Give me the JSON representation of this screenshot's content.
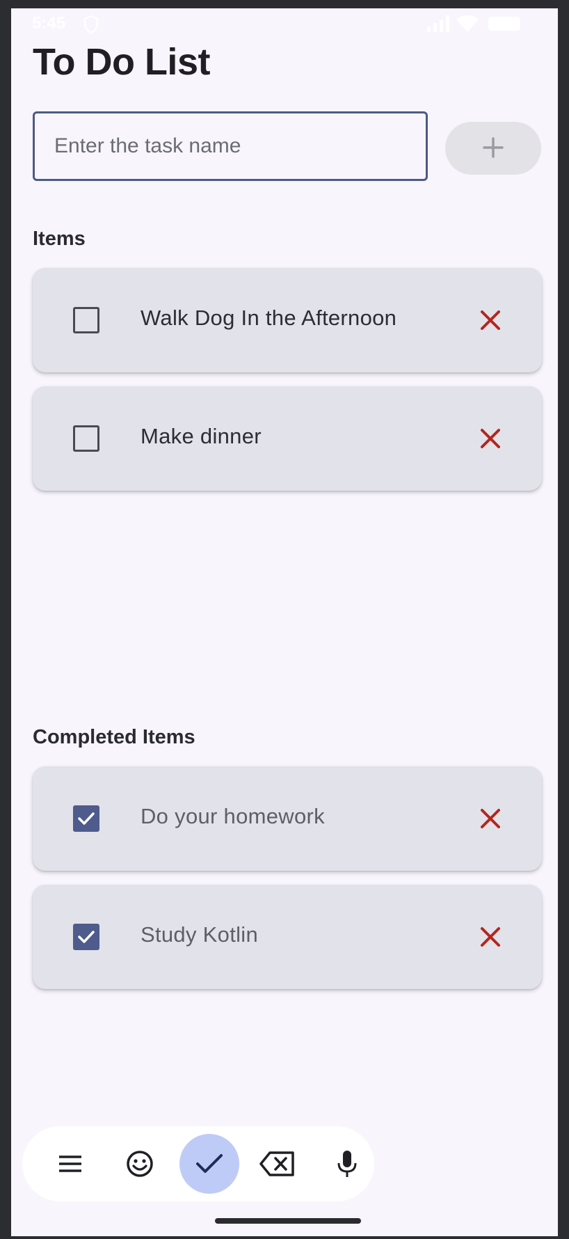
{
  "status_bar": {
    "time": "5:45",
    "icons": [
      "shield-icon",
      "signal-icon",
      "wifi-icon",
      "battery-icon"
    ]
  },
  "header": {
    "title": "To Do List"
  },
  "new_task": {
    "placeholder": "Enter the task name",
    "add_icon": "plus-icon",
    "value": ""
  },
  "sections": {
    "items_label": "Items",
    "completed_label": "Completed Items"
  },
  "items": [
    {
      "label": "Walk Dog In the Afternoon",
      "checked": false
    },
    {
      "label": "Make dinner",
      "checked": false
    }
  ],
  "completed_items": [
    {
      "label": "Do your homework",
      "checked": true
    },
    {
      "label": "Study Kotlin",
      "checked": true
    }
  ],
  "keyboard_toolbar": {
    "buttons": [
      "menu-icon",
      "emoji-icon",
      "check-icon",
      "backspace-icon",
      "mic-icon"
    ],
    "active": "check-icon"
  },
  "colors": {
    "background": "#f8f5fc",
    "card": "#e2e2ea",
    "accent": "#4f5b8c",
    "delete": "#b3261e",
    "active_key": "#bfcbf7"
  }
}
